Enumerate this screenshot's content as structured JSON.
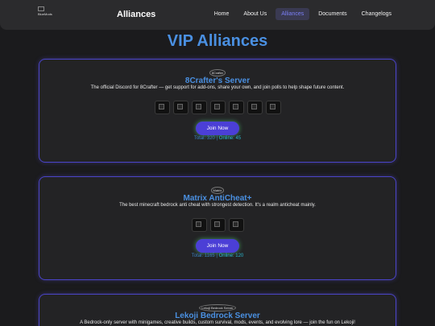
{
  "nav": {
    "logo_text": "BlueMods",
    "title": "Alliances",
    "links": [
      "Home",
      "About Us",
      "Alliances",
      "Documents",
      "Changelogs"
    ]
  },
  "page": {
    "title": "VIP Alliances"
  },
  "cards": [
    {
      "logo_alt": "8Crafter",
      "title": "8Crafter's Server",
      "description": "The official Discord for 8Crafter — get support for add-ons, share your own, and join polls to help shape future content.",
      "join_label": "Join Now",
      "total": "Total: 320",
      "separator": "|",
      "online": "Online: 45"
    },
    {
      "logo_alt": "Matrix",
      "title": "Matrix AntiCheat+",
      "description": "The best minecraft bedrock anti cheat with strongest detection. It's a realm anticheat mainly.",
      "join_label": "Join Now",
      "total": "Total: 1165",
      "separator": "|",
      "online": "Online: 120"
    },
    {
      "logo_alt": "Lekoji Bedrock Server",
      "title": "Lekoji Bedrock Server",
      "description": "A Bedrock-only server with minigames, creative builds, custom survival, mods, events, and evolving lore — join the fun on Lekoji!"
    }
  ],
  "colors": {
    "accent": "#4a90e2",
    "border": "#4a44c8",
    "button": "#4b3fd6",
    "counts": "#2bb8cf"
  }
}
